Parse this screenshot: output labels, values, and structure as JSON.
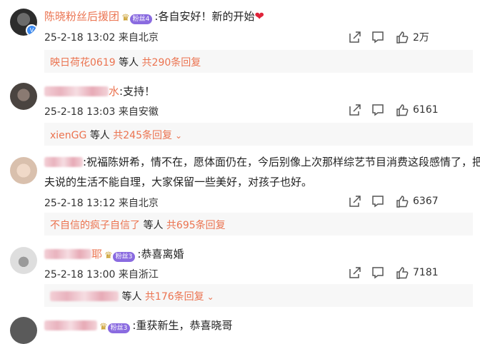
{
  "comments": [
    {
      "username": "陈晓粉丝后援团",
      "username_blurred": false,
      "fan_level": "粉丝4",
      "text": ":各自安好！新的开始",
      "has_heart": true,
      "meta": "25-2-18 13:02 来自北京",
      "likes": "2万",
      "reply_by": "映日荷花0619",
      "reply_suffix": "等人",
      "reply_count": "共290条回复"
    },
    {
      "username_blurred": true,
      "username_visible_tail": "水",
      "text": ":支持！",
      "meta": "25-2-18 13:03 来自安徽",
      "likes": "6161",
      "reply_by": "xienGG",
      "reply_suffix": "等人",
      "reply_count": "共245条回复"
    },
    {
      "username_blurred": true,
      "text_line1": ":祝福陈妍希，情不在，愿体面仍在，今后别像上次那样综艺节目消费这段感情了，把前",
      "text_line2": "夫说的生活不能自理，大家保留一些美好，对孩子也好。",
      "meta": "25-2-18 13:12 来自北京",
      "likes": "6367",
      "reply_by": "不自信的疯子自信了",
      "reply_suffix": "等人",
      "reply_count": "共695条回复"
    },
    {
      "username_blurred": true,
      "username_visible_tail": "耶",
      "fan_level": "粉丝3",
      "text": ":恭喜离婚",
      "meta": "25-2-18 13:00 来自浙江",
      "likes": "7181",
      "reply_by": "",
      "reply_suffix": "等人",
      "reply_count": "共176条回复"
    },
    {
      "username_blurred": true,
      "fan_level": "粉丝3",
      "text": ":重获新生，恭喜晓哥"
    }
  ],
  "colors": {
    "username": "#eb7350",
    "fan_badge": "#8a6be0",
    "heart": "#e0243a",
    "reply_bg": "#f7f7f7"
  },
  "icons": [
    "share-icon",
    "comment-icon",
    "like-icon",
    "chevron-down-icon",
    "verified-badge-icon",
    "crown-icon"
  ]
}
